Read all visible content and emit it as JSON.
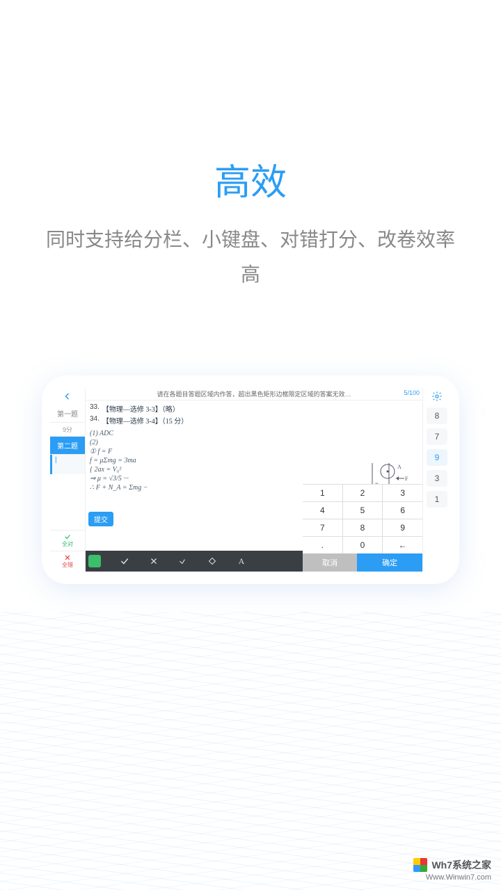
{
  "title": "高效",
  "subtitle": "同时支持给分栏、小键盘、对错打分、改卷效率高",
  "grader": {
    "instruction": "请在各题目答题区域内作答，超出黑色矩形边框限定区域的答案无效…",
    "progress": "5/100",
    "left": {
      "q1": "第一题",
      "q1_score": "9分",
      "q2": "第二题",
      "q2_input": "|",
      "all_correct": "全对",
      "all_wrong": "全错"
    },
    "paper": {
      "l33_num": "33.",
      "l33_txt": "【物理—选修 3-3】（略）",
      "l34_num": "34.",
      "l34_txt": "【物理—选修 3-4】（15 分）",
      "a1": "(1) ADC",
      "a2": "(2)",
      "e1": "① f = F",
      "e2": "   f = μΣmg = 3ma",
      "e3": "  { 2ax = V₀²",
      "e4": "⇒ μ = √3/5 ···",
      "e5": "∴ F + N_A = Σmg −",
      "diag_A": "A",
      "diag_F": "F",
      "diag_P": "P"
    },
    "submit": "提交",
    "keypad": {
      "keys": [
        "1",
        "2",
        "3",
        "4",
        "5",
        "6",
        "7",
        "8",
        "9",
        ".",
        "0",
        "←"
      ],
      "cancel": "取消",
      "confirm": "确定"
    },
    "scores": [
      "8",
      "7",
      "9",
      "3",
      "1"
    ],
    "score_active": 2
  },
  "watermark": {
    "brand": "Wh7系统之家",
    "url": "Www.Winwin7.com"
  }
}
